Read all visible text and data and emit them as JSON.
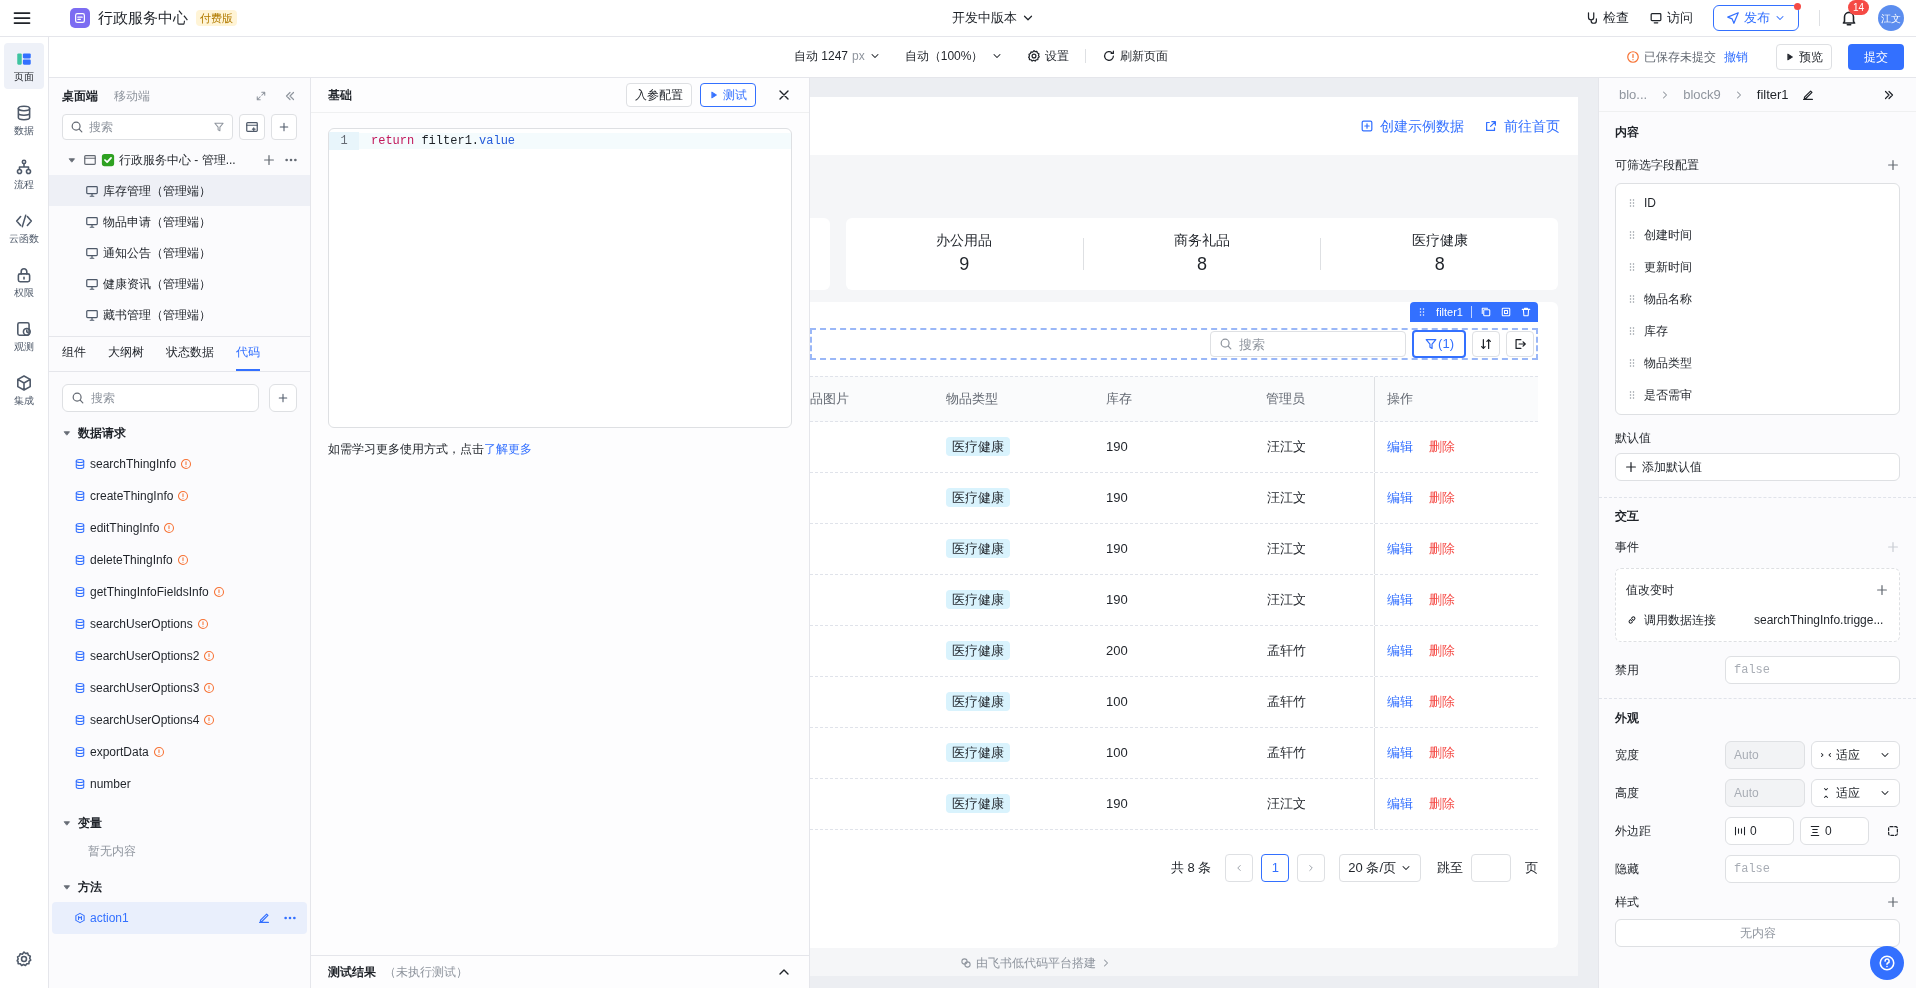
{
  "app": {
    "title": "行政服务中心",
    "badge": "付费版"
  },
  "version": "开发中版本",
  "top_actions": [
    {
      "label": "检查",
      "kind": "inspect"
    },
    {
      "label": "访问",
      "kind": "visit"
    }
  ],
  "publish": {
    "label": "发布",
    "dot": true
  },
  "notifications": {
    "count": "14"
  },
  "avatar": "江文",
  "rail": [
    {
      "label": "页面",
      "kind": "page",
      "selected": true
    },
    {
      "label": "数据",
      "kind": "data",
      "selected": false
    },
    {
      "label": "流程",
      "kind": "flow",
      "selected": false
    },
    {
      "label": "云函数",
      "kind": "code",
      "selected": false
    },
    {
      "label": "权限",
      "kind": "lock",
      "selected": false
    },
    {
      "label": "观测",
      "kind": "watch",
      "selected": false
    },
    {
      "label": "集成",
      "kind": "box",
      "selected": false
    }
  ],
  "toolbar": {
    "width": "自动 1247",
    "unit": "px",
    "zoom": "自动（100%）",
    "settings": "设置",
    "refresh": "刷新页面",
    "save_status": "已保存未提交",
    "revert": "撤销",
    "preview": "预览",
    "submit": "提交"
  },
  "left_panel": {
    "tabs": [
      {
        "label": "桌面端",
        "selected": true
      },
      {
        "label": "移动端",
        "selected": false
      }
    ],
    "search": {
      "placeholder": "搜索"
    },
    "tree": [
      {
        "label": "行政服务中心 - 管理...",
        "expanded": true,
        "selected": false,
        "children": [
          {
            "label": "库存管理（管理端）",
            "selected": true
          },
          {
            "label": "物品申请（管理端）",
            "selected": false
          },
          {
            "label": "通知公告（管理端）",
            "selected": false
          },
          {
            "label": "健康资讯（管理端）",
            "selected": false
          },
          {
            "label": "藏书管理（管理端）",
            "selected": false
          }
        ]
      }
    ],
    "bottom_tabs": [
      {
        "label": "组件",
        "selected": false
      },
      {
        "label": "大纲树",
        "selected": false
      },
      {
        "label": "状态数据",
        "selected": false
      },
      {
        "label": "代码",
        "selected": true
      }
    ],
    "code_search": {
      "placeholder": "搜索"
    },
    "sections": [
      {
        "title": "数据请求",
        "expanded": true,
        "items": [
          {
            "name": "searchThingInfo",
            "kind": "request",
            "warning": true,
            "selected": false
          },
          {
            "name": "createThingInfo",
            "kind": "request",
            "warning": true,
            "selected": false
          },
          {
            "name": "editThingInfo",
            "kind": "request",
            "warning": true,
            "selected": false
          },
          {
            "name": "deleteThingInfo",
            "kind": "request",
            "warning": true,
            "selected": false
          },
          {
            "name": "getThingInfoFieldsInfo",
            "kind": "request",
            "warning": true,
            "selected": false
          },
          {
            "name": "searchUserOptions",
            "kind": "request",
            "warning": true,
            "selected": false
          },
          {
            "name": "searchUserOptions2",
            "kind": "request",
            "warning": true,
            "selected": false
          },
          {
            "name": "searchUserOptions3",
            "kind": "request",
            "warning": true,
            "selected": false
          },
          {
            "name": "searchUserOptions4",
            "kind": "request",
            "warning": true,
            "selected": false
          },
          {
            "name": "exportData",
            "kind": "request",
            "warning": true,
            "selected": false
          },
          {
            "name": "number",
            "kind": "request",
            "warning": false,
            "selected": false
          }
        ]
      },
      {
        "title": "变量",
        "expanded": true,
        "empty": "暂无内容"
      },
      {
        "title": "方法",
        "expanded": true,
        "items": [
          {
            "name": "action1",
            "kind": "method",
            "warning": false,
            "selected": true
          }
        ]
      }
    ]
  },
  "code_panel": {
    "title": "基础",
    "params_button": "入参配置",
    "test_button": "测试",
    "lines": [
      {
        "number": "1",
        "tokens": [
          {
            "text": "return",
            "kind": "keyword"
          },
          {
            "text": " filter1.",
            "kind": "plain"
          },
          {
            "text": "value",
            "kind": "property"
          }
        ]
      }
    ],
    "help": "如需学习更多使用方式，点击",
    "help_link": "了解更多",
    "result_title": "测试结果",
    "result_status": "（未执行测试）"
  },
  "canvas": {
    "header_links": [
      {
        "label": "创建示例数据",
        "kind": "create"
      },
      {
        "label": "前往首页",
        "kind": "open"
      }
    ],
    "stats": [
      {
        "label": "办公用品",
        "value": "9"
      },
      {
        "label": "商务礼品",
        "value": "8"
      },
      {
        "label": "医疗健康",
        "value": "8"
      }
    ],
    "selection_tag": "filter1",
    "search": {
      "placeholder": "搜索"
    },
    "filter_button": "(1)",
    "table": {
      "columns": [
        "品图片",
        "物品类型",
        "库存",
        "管理员",
        "操作"
      ],
      "rows": [
        {
          "type": "医疗健康",
          "stock": "190",
          "admin": "汪江文",
          "actions": [
            "编辑",
            "删除"
          ]
        },
        {
          "type": "医疗健康",
          "stock": "190",
          "admin": "汪江文",
          "actions": [
            "编辑",
            "删除"
          ]
        },
        {
          "type": "医疗健康",
          "stock": "190",
          "admin": "汪江文",
          "actions": [
            "编辑",
            "删除"
          ]
        },
        {
          "type": "医疗健康",
          "stock": "190",
          "admin": "汪江文",
          "actions": [
            "编辑",
            "删除"
          ]
        },
        {
          "type": "医疗健康",
          "stock": "200",
          "admin": "孟轩竹",
          "actions": [
            "编辑",
            "删除"
          ]
        },
        {
          "type": "医疗健康",
          "stock": "100",
          "admin": "孟轩竹",
          "actions": [
            "编辑",
            "删除"
          ]
        },
        {
          "type": "医疗健康",
          "stock": "100",
          "admin": "孟轩竹",
          "actions": [
            "编辑",
            "删除"
          ]
        },
        {
          "type": "医疗健康",
          "stock": "190",
          "admin": "汪江文",
          "actions": [
            "编辑",
            "删除"
          ]
        }
      ]
    },
    "pagination": {
      "total": "共 8 条",
      "pages": [
        {
          "label": "1",
          "selected": true
        }
      ],
      "page_size": "20 条/页",
      "jump_label": "跳至",
      "jump_suffix": "页"
    },
    "footer": "由飞书低代码平台搭建"
  },
  "right_panel": {
    "breadcrumb": [
      "blo...",
      "block9",
      "filter1"
    ],
    "content_title": "内容",
    "fields_title": "可筛选字段配置",
    "fields": [
      "ID",
      "创建时间",
      "更新时间",
      "物品名称",
      "库存",
      "物品类型",
      "是否需审"
    ],
    "default_title": "默认值",
    "add_default": "添加默认值",
    "interaction_title": "交互",
    "events_title": "事件",
    "event": {
      "name": "值改变时",
      "action": "调用数据连接",
      "target": "searchThingInfo.trigge..."
    },
    "disabled": {
      "label": "禁用",
      "placeholder": "false"
    },
    "appearance_title": "外观",
    "width": {
      "label": "宽度",
      "placeholder": "Auto",
      "mode": "适应"
    },
    "height": {
      "label": "高度",
      "placeholder": "Auto",
      "mode": "适应"
    },
    "margin": {
      "label": "外边距",
      "horizontal": "0",
      "vertical": "0"
    },
    "hidden": {
      "label": "隐藏",
      "placeholder": "false"
    },
    "style_title": "样式",
    "style_empty": "无内容"
  }
}
